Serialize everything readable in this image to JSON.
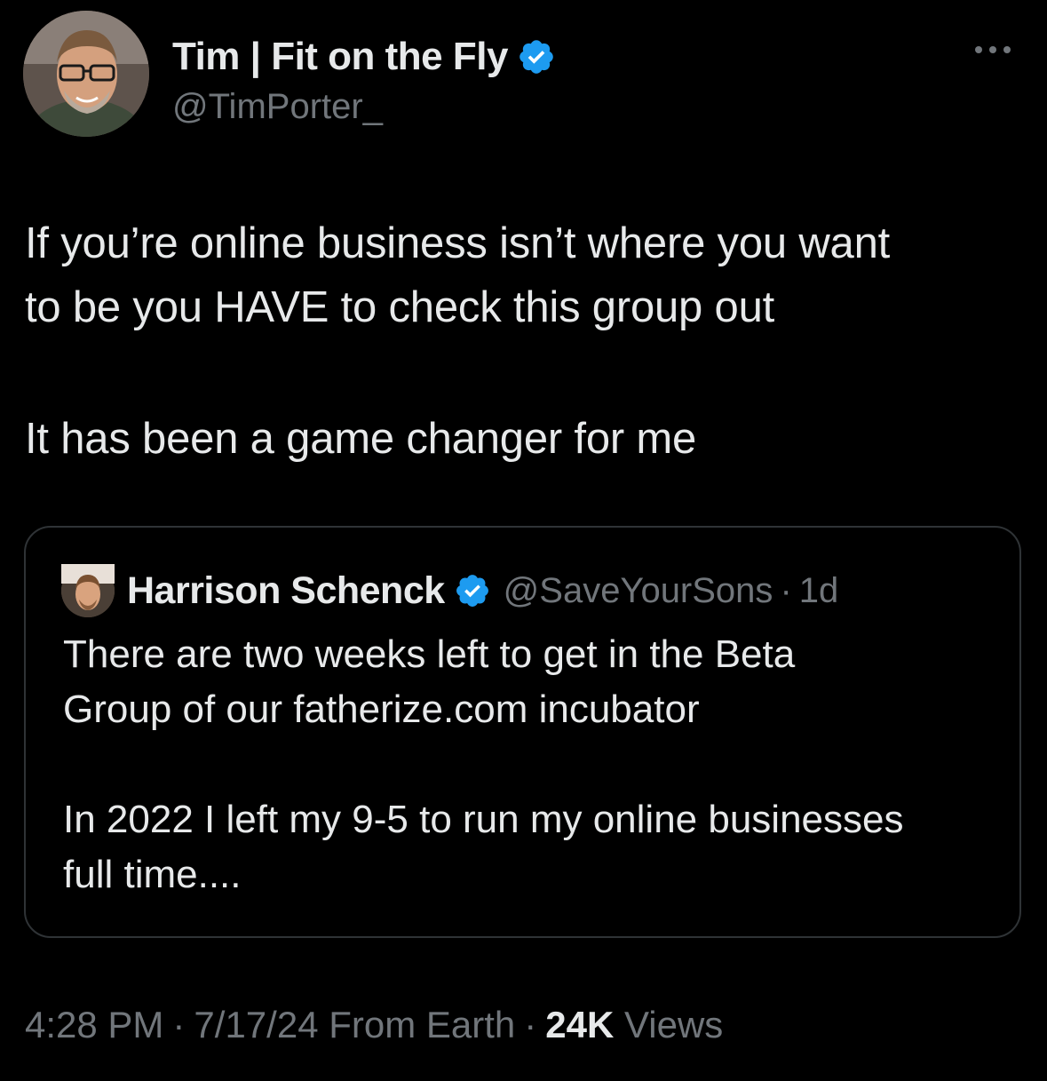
{
  "tweet": {
    "author": {
      "display_name": "Tim | Fit on the Fly",
      "handle": "@TimPorter_",
      "verified": true,
      "avatar_icon": "profile-photo"
    },
    "body": {
      "paragraph_1_line_1": "If you’re online business isn’t where you want",
      "paragraph_1_line_2": "to be you HAVE to check this group out",
      "paragraph_2": "It has been a game changer for me"
    },
    "quoted_tweet": {
      "display_name": "Harrison Schenck",
      "handle": "@SaveYourSons",
      "separator": "·",
      "time": "1d",
      "verified": true,
      "text_line_1": "There are two weeks left to get in the Beta",
      "text_line_2": "Group of our fatherize.com incubator",
      "text_line_3": "In 2022 I left my 9-5 to run my online businesses",
      "text_line_4": "full time...."
    },
    "meta": {
      "time": "4:28 PM",
      "separator_1": "·",
      "date": "7/17/24",
      "source": "From Earth",
      "separator_2": "·",
      "views_count": "24K",
      "views_label": "Views"
    }
  },
  "colors": {
    "background": "#000000",
    "text_primary": "#e7e9ea",
    "text_secondary": "#71767b",
    "verified_blue": "#1d9bf0",
    "border": "#2f3336"
  },
  "icons": {
    "verified": "verified-badge-icon",
    "more": "more-options-icon"
  }
}
